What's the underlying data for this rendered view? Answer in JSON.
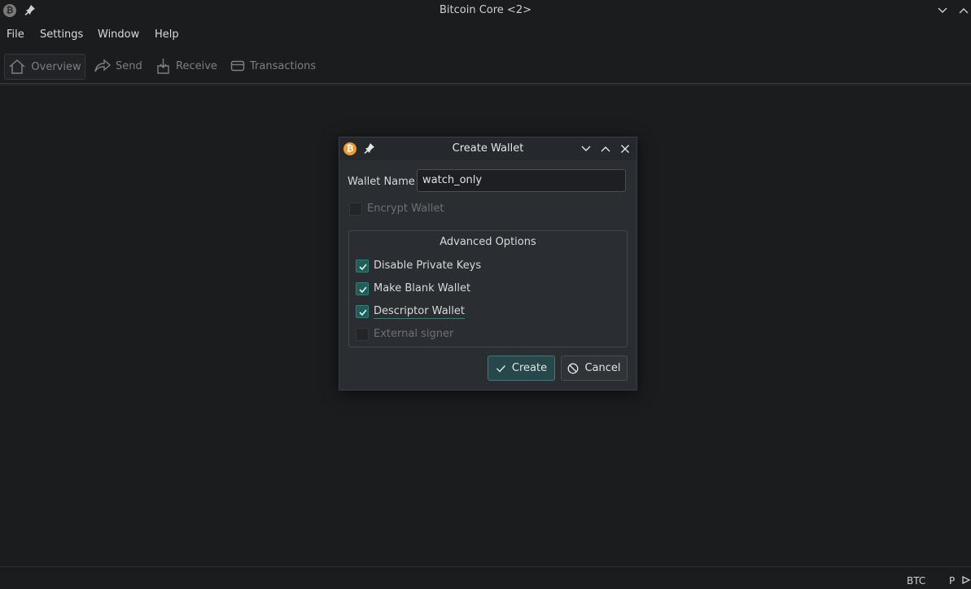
{
  "window": {
    "title": "Bitcoin Core <2>",
    "app_icon_glyph": "₿"
  },
  "menu": [
    "File",
    "Settings",
    "Window",
    "Help"
  ],
  "toolbar": {
    "overview": "Overview",
    "send": "Send",
    "receive": "Receive",
    "transactions": "Transactions"
  },
  "status": {
    "unit": "BTC",
    "p": "P"
  },
  "dialog": {
    "title": "Create Wallet",
    "icon_glyph": "₿",
    "wallet_name_label": "Wallet Name",
    "wallet_name_value": "watch_only",
    "encrypt_label": "Encrypt Wallet",
    "encrypt_checked": false,
    "advanced_title": "Advanced Options",
    "options": [
      {
        "label": "Disable Private Keys",
        "checked": true
      },
      {
        "label": "Make Blank Wallet",
        "checked": true
      },
      {
        "label": "Descriptor Wallet",
        "checked": true
      },
      {
        "label": "External signer",
        "checked": false
      }
    ],
    "create_label": "Create",
    "cancel_label": "Cancel"
  },
  "colors": {
    "accent": "#2b8079",
    "bitcoin": "#f09a2e",
    "background": "#1b1c1e"
  }
}
